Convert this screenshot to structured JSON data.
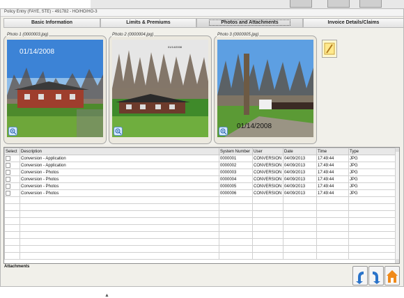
{
  "window": {
    "title": "Policy Entry (FAYE, STE) - 491782 - HO/HO/HO-3"
  },
  "tabs": [
    {
      "label": "Basic Information"
    },
    {
      "label": "Limits & Premiums"
    },
    {
      "label": "Photos and Attachments",
      "active": true
    },
    {
      "label": "Invoice Details/Claims"
    }
  ],
  "photos": [
    {
      "label": "Photo 1 (0000003.jpg)",
      "date_stamp": "01/14/2008"
    },
    {
      "label": "Photo 2 (0000004.jpg)",
      "date_stamp": "01/14/2008"
    },
    {
      "label": "Photo 3 (0000005.jpg)",
      "date_stamp": "01/14/2008"
    }
  ],
  "table": {
    "columns": [
      "Select",
      "Description",
      "System Number",
      "User",
      "Date",
      "Time",
      "Type"
    ],
    "rows": [
      {
        "description": "Conversion - Application",
        "system_number": "0000001",
        "user": "CONVERSION",
        "date": "04/09/2013",
        "time": "17:49:44",
        "type": "JPG"
      },
      {
        "description": "Conversion - Application",
        "system_number": "0000002",
        "user": "CONVERSION",
        "date": "04/09/2013",
        "time": "17:49:44",
        "type": "JPG"
      },
      {
        "description": "Conversion - Photos",
        "system_number": "0000003",
        "user": "CONVERSION",
        "date": "04/09/2013",
        "time": "17:49:44",
        "type": "JPG"
      },
      {
        "description": "Conversion - Photos",
        "system_number": "0000004",
        "user": "CONVERSION",
        "date": "04/09/2013",
        "time": "17:49:44",
        "type": "JPG"
      },
      {
        "description": "Conversion - Photos",
        "system_number": "0000005",
        "user": "CONVERSION",
        "date": "04/09/2013",
        "time": "17:49:44",
        "type": "JPG"
      },
      {
        "description": "Conversion - Photos",
        "system_number": "0000006",
        "user": "CONVERSION",
        "date": "04/09/2013",
        "time": "17:49:44",
        "type": "JPG"
      }
    ]
  },
  "attachments_label": "Attachments",
  "icons": {
    "pencil": "pencil-icon",
    "zoom": "zoom-in-icon",
    "back": "back-arrow-icon",
    "forward": "forward-arrow-icon",
    "home": "home-icon"
  }
}
